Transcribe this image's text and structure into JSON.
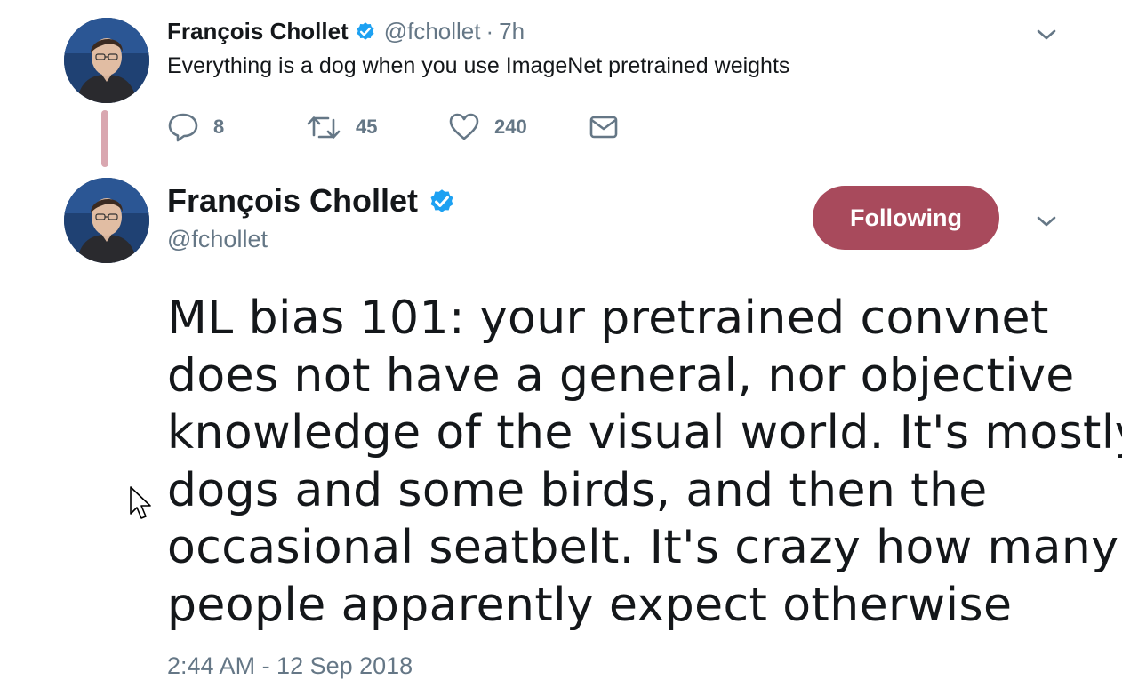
{
  "parent_tweet": {
    "author_name": "François Chollet",
    "handle": "@fchollet",
    "separator": "·",
    "time": "7h",
    "text": "Everything is a dog when you use ImageNet pretrained weights",
    "avatar_icon": "user-avatar",
    "actions": {
      "reply_icon": "reply-icon",
      "reply_count": "8",
      "retweet_icon": "retweet-icon",
      "retweet_count": "45",
      "like_icon": "heart-icon",
      "like_count": "240",
      "dm_icon": "envelope-icon"
    }
  },
  "main_tweet": {
    "author_name": "François Chollet",
    "handle": "@fchollet",
    "follow_button_label": "Following",
    "text_lines": [
      "ML bias 101: your pretrained convnet",
      "does not have a general, nor objective",
      "knowledge of the visual world. It's mostly",
      "dogs and some birds, and then the",
      "occasional seatbelt. It's crazy how many",
      "people apparently expect otherwise"
    ],
    "timestamp": "2:44 AM - 12 Sep 2018"
  },
  "colors": {
    "text": "#14171a",
    "secondary": "#657786",
    "verified": "#1da1f2",
    "follow_button": "#a84a5c",
    "thread_line": "#d9a7b0"
  }
}
